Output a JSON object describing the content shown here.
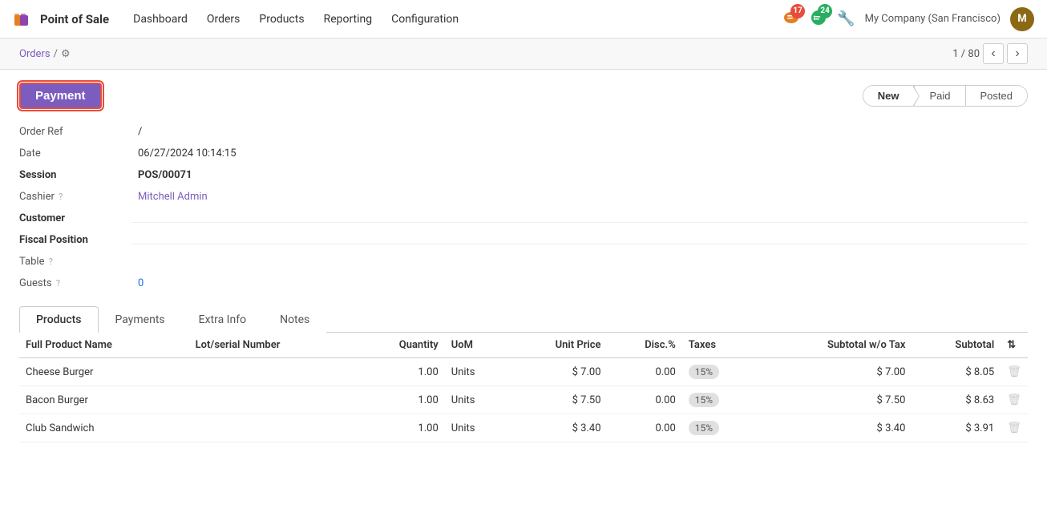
{
  "app": {
    "name": "Point of Sale"
  },
  "topnav": {
    "menu": [
      "Dashboard",
      "Orders",
      "Products",
      "Reporting",
      "Configuration"
    ],
    "notifications": {
      "messages_count": "17",
      "activities_count": "24"
    },
    "company": "My Company (San Francisco)",
    "avatar_initials": "M"
  },
  "breadcrumb": {
    "parent": "Orders",
    "separator": "/",
    "gear_label": "⚙"
  },
  "pagination": {
    "current": "1",
    "total": "80",
    "display": "1 / 80"
  },
  "toolbar": {
    "payment_label": "Payment",
    "status_new": "New",
    "status_paid": "Paid",
    "status_posted": "Posted"
  },
  "form": {
    "order_ref_label": "Order Ref",
    "order_ref_value": "/",
    "date_label": "Date",
    "date_value": "06/27/2024 10:14:15",
    "session_label": "Session",
    "session_value": "POS/00071",
    "cashier_label": "Cashier",
    "cashier_value": "Mitchell Admin",
    "customer_label": "Customer",
    "fiscal_position_label": "Fiscal Position",
    "table_label": "Table",
    "guests_label": "Guests",
    "guests_value": "0"
  },
  "tabs": [
    "Products",
    "Payments",
    "Extra Info",
    "Notes"
  ],
  "active_tab": "Products",
  "table": {
    "columns": [
      "Full Product Name",
      "Lot/serial Number",
      "Quantity",
      "UoM",
      "Unit Price",
      "Disc.%",
      "Taxes",
      "Subtotal w/o Tax",
      "Subtotal",
      "⇅"
    ],
    "rows": [
      {
        "name": "Cheese Burger",
        "lot": "",
        "qty": "1.00",
        "uom": "Units",
        "unit_price": "$ 7.00",
        "disc": "0.00",
        "tax": "15%",
        "subtotal_wo_tax": "$ 7.00",
        "subtotal": "$ 8.05"
      },
      {
        "name": "Bacon Burger",
        "lot": "",
        "qty": "1.00",
        "uom": "Units",
        "unit_price": "$ 7.50",
        "disc": "0.00",
        "tax": "15%",
        "subtotal_wo_tax": "$ 7.50",
        "subtotal": "$ 8.63"
      },
      {
        "name": "Club Sandwich",
        "lot": "",
        "qty": "1.00",
        "uom": "Units",
        "unit_price": "$ 3.40",
        "disc": "0.00",
        "tax": "15%",
        "subtotal_wo_tax": "$ 3.40",
        "subtotal": "$ 3.91"
      }
    ]
  }
}
